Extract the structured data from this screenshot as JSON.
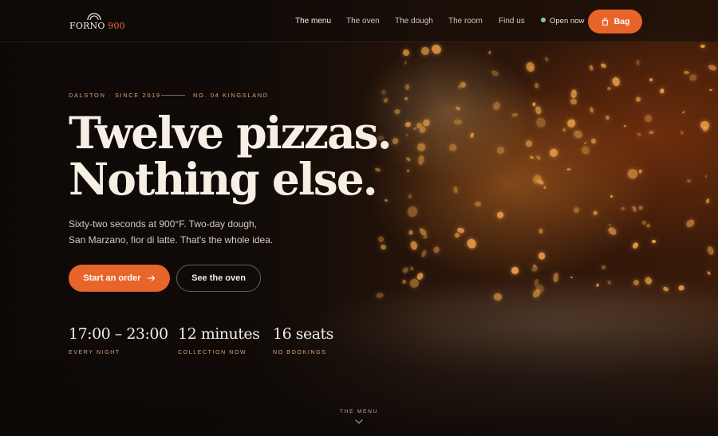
{
  "brand": {
    "name": "FORNO",
    "number": "900"
  },
  "nav": {
    "links": [
      {
        "label": "The menu",
        "active": true
      },
      {
        "label": "The oven",
        "active": false
      },
      {
        "label": "The dough",
        "active": false
      },
      {
        "label": "The room",
        "active": false
      },
      {
        "label": "Find us",
        "active": false
      }
    ],
    "status": "Open now",
    "bag_label": "Bag"
  },
  "hero": {
    "eyebrow_left": "DALSTON · SINCE 2019",
    "eyebrow_right": "NO. 04 KINGSLAND",
    "headline_line1": "Twelve pizzas.",
    "headline_line2": "Nothing else.",
    "sub_line1": "Sixty-two seconds at 900°F. Two-day dough,",
    "sub_line2": "San Marzano, fior di latte. That's the whole idea.",
    "primary_cta": "Start an order",
    "secondary_cta": "See the oven"
  },
  "stats": [
    {
      "value": "17:00 – 23:00",
      "label": "EVERY NIGHT"
    },
    {
      "value": "12 minutes",
      "label": "COLLECTION NOW"
    },
    {
      "value": "16 seats",
      "label": "NO BOOKINGS"
    }
  ],
  "scroll_cue": {
    "label": "THE MENU"
  },
  "colors": {
    "accent": "#e8652a",
    "eyebrow": "#d9a477",
    "status_dot": "#7fd08a"
  }
}
